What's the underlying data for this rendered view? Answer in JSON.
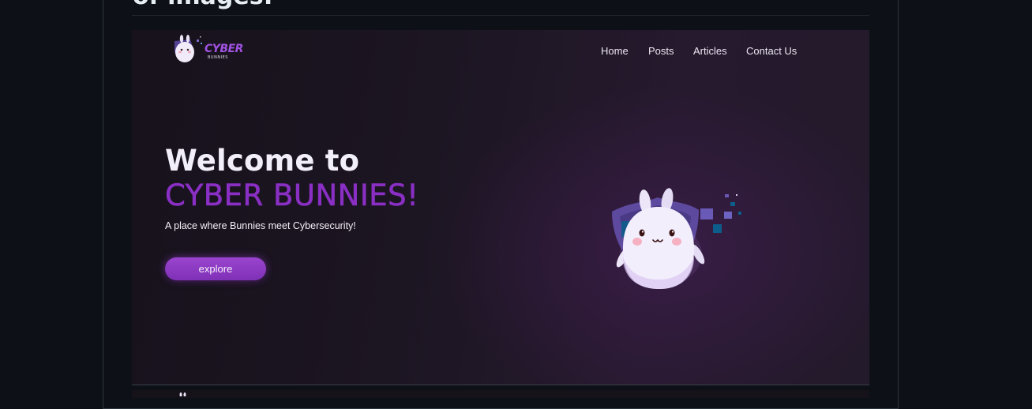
{
  "page": {
    "section_heading": "of images:"
  },
  "site": {
    "logo": {
      "wordmark": "CYBER",
      "subtext": "BUNNIES",
      "icon": "bunny-logo-icon"
    },
    "nav": {
      "items": [
        {
          "label": "Home"
        },
        {
          "label": "Posts"
        },
        {
          "label": "Articles"
        },
        {
          "label": "Contact Us"
        }
      ]
    },
    "hero": {
      "title": "Welcome to",
      "brand": "CYBER BUNNIES!",
      "tagline": "A place where Bunnies meet Cybersecurity!",
      "cta_label": "explore",
      "illustration": "bunny-shield-illustration"
    }
  },
  "colors": {
    "page_background": "#0d1117",
    "hero_background": "#1c1522",
    "accent_purple": "#8a2fc4",
    "button_purple": "#9a44cf",
    "text_light": "#f2eefa"
  }
}
